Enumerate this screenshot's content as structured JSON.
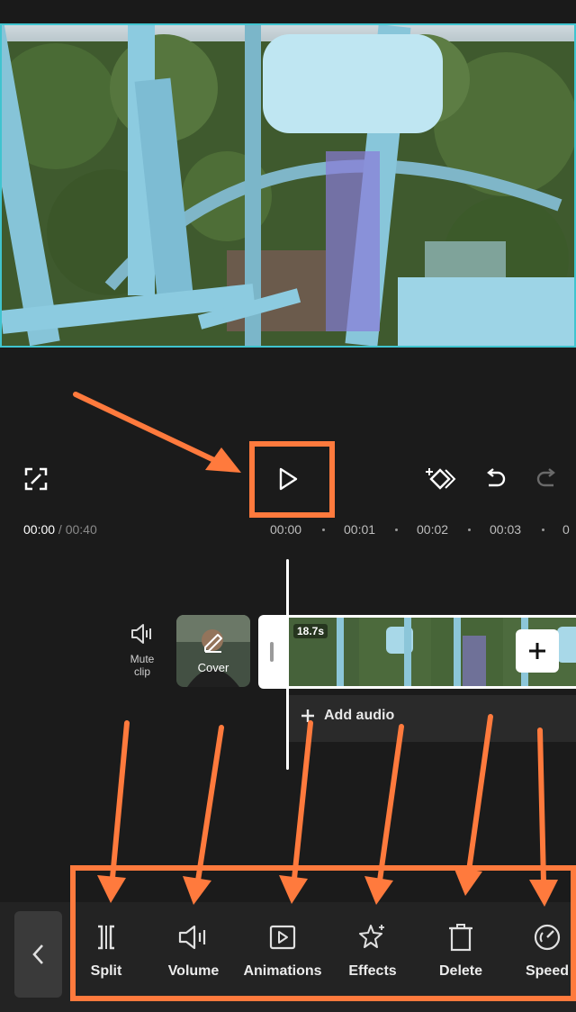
{
  "player": {
    "current_time": "00:00",
    "separator": " / ",
    "total_time": "00:40"
  },
  "ruler": {
    "ticks": [
      "00:00",
      "00:01",
      "00:02",
      "00:03"
    ]
  },
  "track": {
    "mute_label_line1": "Mute",
    "mute_label_line2": "clip",
    "cover_label": "Cover",
    "clip_duration": "18.7s",
    "add_audio_label": "Add audio"
  },
  "toolbar": {
    "items": [
      {
        "label": "Split",
        "icon": "split-icon"
      },
      {
        "label": "Volume",
        "icon": "volume-icon"
      },
      {
        "label": "Animations",
        "icon": "animations-icon"
      },
      {
        "label": "Effects",
        "icon": "effects-icon"
      },
      {
        "label": "Delete",
        "icon": "delete-icon"
      },
      {
        "label": "Speed",
        "icon": "speed-icon"
      }
    ]
  },
  "colors": {
    "accent_border": "#40c4cf",
    "annotation": "#ff7a3d",
    "background": "#1b1b1b"
  }
}
